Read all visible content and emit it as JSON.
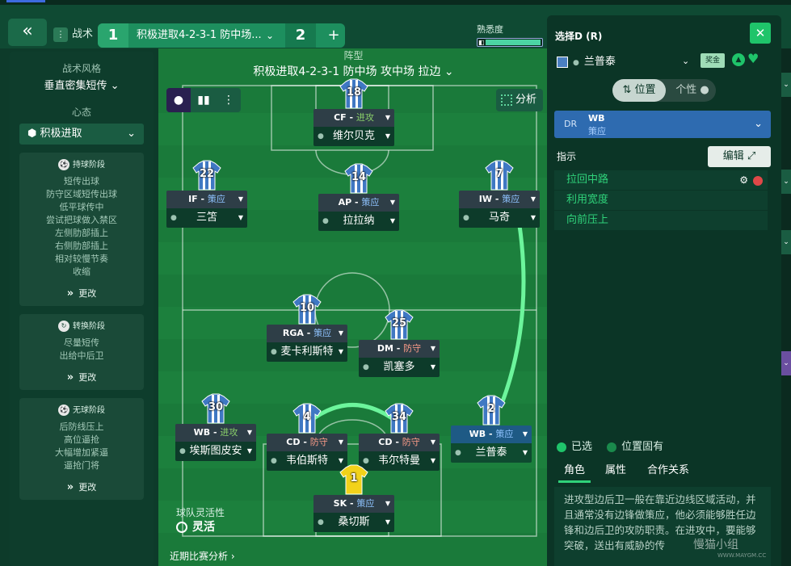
{
  "header": {
    "back_icon": "double-chevron-left",
    "tactic_tab": "战术",
    "slot1_num": "1",
    "slot1_name": "积极进取4-2-3-1 防中场...",
    "slot2_num": "2",
    "add": "+",
    "familiarity_label": "熟悉度",
    "familiarity_level": 0.85
  },
  "left": {
    "style_label": "战术风格",
    "style_value": "垂直密集短传",
    "mentality_label": "心态",
    "mentality_value": "积极进取",
    "phases": [
      {
        "title": "持球阶段",
        "items": [
          "短传出球",
          "防守区域短传出球",
          "低平球传中",
          "尝试把球做入禁区",
          "左侧肋部插上",
          "右侧肋部插上",
          "相对较慢节奏",
          "收缩"
        ],
        "more": "更改"
      },
      {
        "title": "转换阶段",
        "items": [
          "尽量短传",
          "出给中后卫"
        ],
        "more": "更改"
      },
      {
        "title": "无球阶段",
        "items": [
          "后防线压上",
          "高位逼抢",
          "大幅增加紧逼",
          "逼抢门将"
        ],
        "more": "更改"
      }
    ]
  },
  "pitch": {
    "formation_label": "阵型",
    "formation_value": "积极进取4-2-3-1 防中场 攻中场 拉边",
    "analyze": "分析",
    "flex_label": "球队灵活性",
    "flex_value": "灵活",
    "recent": "近期比赛分析"
  },
  "players": [
    {
      "num": "18",
      "role": "CF",
      "duty": "进攻",
      "dutyType": "attack",
      "name": "维尔贝克"
    },
    {
      "num": "22",
      "role": "IF",
      "duty": "策应",
      "dutyType": "support",
      "name": "三笘"
    },
    {
      "num": "14",
      "role": "AP",
      "duty": "策应",
      "dutyType": "support",
      "name": "拉拉纳"
    },
    {
      "num": "7",
      "role": "IW",
      "duty": "策应",
      "dutyType": "support",
      "name": "马奇"
    },
    {
      "num": "10",
      "role": "RGA",
      "duty": "策应",
      "dutyType": "support",
      "name": "麦卡利斯特"
    },
    {
      "num": "25",
      "role": "DM",
      "duty": "防守",
      "dutyType": "defend",
      "name": "凯塞多"
    },
    {
      "num": "30",
      "role": "WB",
      "duty": "进攻",
      "dutyType": "attack",
      "name": "埃斯图皮安"
    },
    {
      "num": "4",
      "role": "CD",
      "duty": "防守",
      "dutyType": "defend",
      "name": "韦伯斯特"
    },
    {
      "num": "34",
      "role": "CD",
      "duty": "防守",
      "dutyType": "defend",
      "name": "韦尔特曼"
    },
    {
      "num": "2",
      "role": "WB",
      "duty": "策应",
      "dutyType": "support",
      "name": "兰普泰"
    },
    {
      "num": "1",
      "role": "SK",
      "duty": "策应",
      "dutyType": "support",
      "name": "桑切斯"
    }
  ],
  "right": {
    "title": "选择D (R)",
    "player": "兰普泰",
    "bonus": "奖金",
    "seg_position": "位置",
    "seg_personality": "个性",
    "role_pos": "DR",
    "role_name": "WB",
    "role_duty": "策应",
    "instructions_label": "指示",
    "edit": "编辑",
    "instructions": [
      "拉回中路",
      "利用宽度",
      "向前压上"
    ],
    "legend_selected": "已选",
    "legend_fixed": "位置固有",
    "tabs": [
      "角色",
      "属性",
      "合作关系"
    ],
    "description": "进攻型边后卫一般在靠近边线区域活动，并且通常没有边锋做策应，他必须能够胜任边锋和边后卫的攻防职责。在进攻中，要能够突破，送出有威胁的传"
  },
  "watermark": {
    "main": "慢猫小组",
    "sub": "WWW.MAYGM.CC"
  },
  "colors": {
    "accent": "#2fd27a",
    "role_blue": "#2e6bb0",
    "attack": "#8ad06a",
    "support": "#8fc3ff",
    "defend": "#ff9d8a"
  }
}
